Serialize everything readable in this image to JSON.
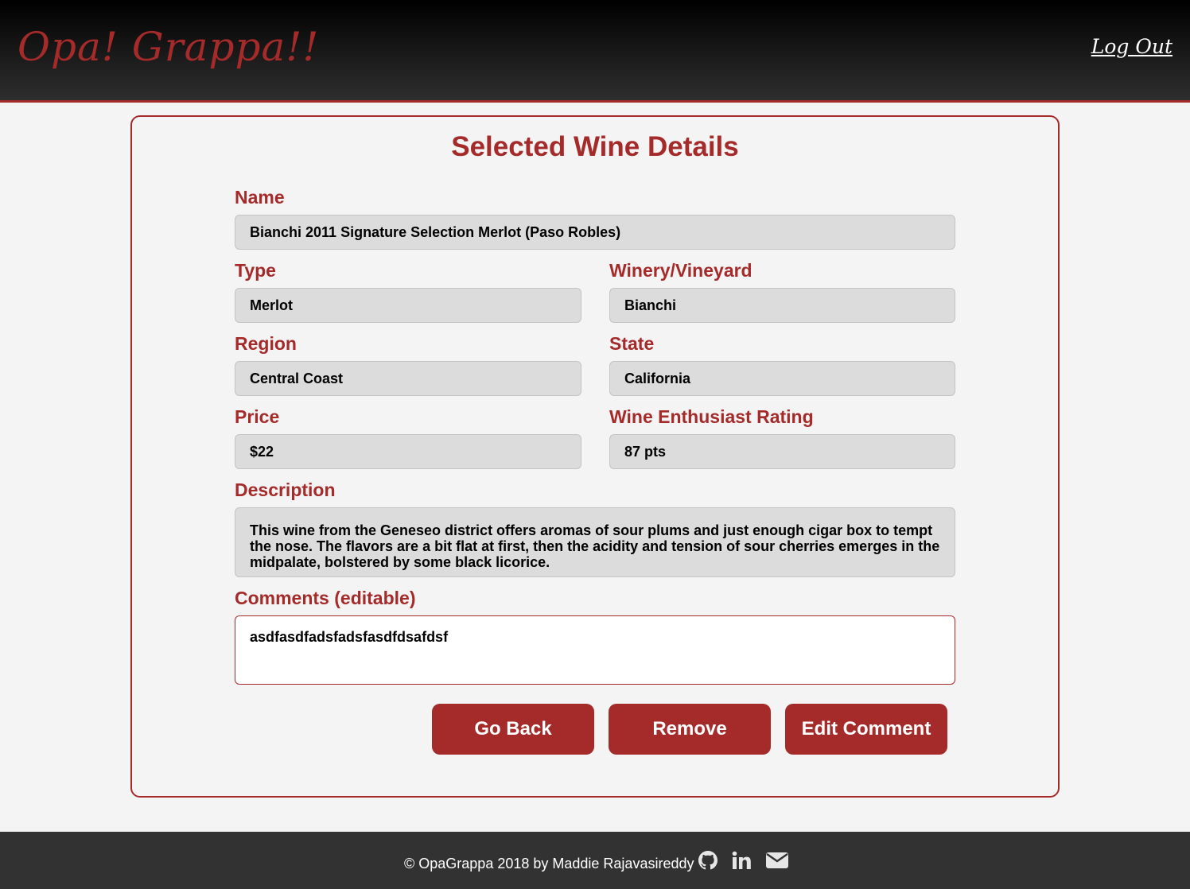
{
  "header": {
    "brand": "Opa! Grappa!!",
    "logout_label": "Log Out"
  },
  "card": {
    "title": "Selected Wine Details",
    "fields": {
      "name": {
        "label": "Name",
        "value": "Bianchi 2011 Signature Selection Merlot (Paso Robles)"
      },
      "type": {
        "label": "Type",
        "value": "Merlot"
      },
      "winery": {
        "label": "Winery/Vineyard",
        "value": "Bianchi"
      },
      "region": {
        "label": "Region",
        "value": "Central Coast"
      },
      "state": {
        "label": "State",
        "value": "California"
      },
      "price": {
        "label": "Price",
        "value": "$22"
      },
      "rating": {
        "label": "Wine Enthusiast Rating",
        "value": "87 pts"
      },
      "description": {
        "label": "Description",
        "value": "This wine from the Geneseo district offers aromas of sour plums and just enough cigar box to tempt the nose. The flavors are a bit flat at first, then the acidity and tension of sour cherries emerges in the midpalate, bolstered by some black licorice."
      },
      "comments": {
        "label": "Comments (editable)",
        "value": "asdfasdfadsfadsfasdfdsafdsf"
      }
    },
    "buttons": {
      "go_back": "Go Back",
      "remove": "Remove",
      "edit_comment": "Edit Comment"
    }
  },
  "footer": {
    "text": "© OpaGrappa 2018 by Maddie Rajavasireddy",
    "icons": [
      "github-icon",
      "linkedin-icon",
      "email-icon"
    ]
  },
  "colors": {
    "accent": "#a52a2a",
    "header_bg": "#000000",
    "footer_bg": "#323232",
    "field_bg": "#dcdcdc",
    "page_bg": "#f4f4f4"
  }
}
